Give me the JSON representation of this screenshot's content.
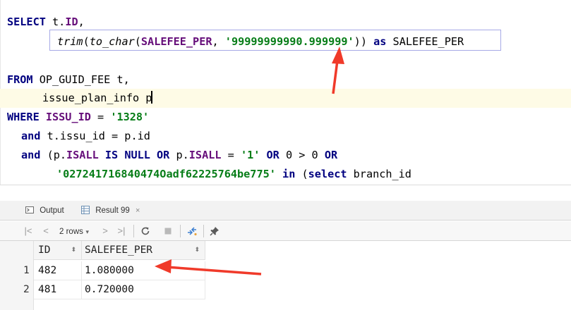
{
  "editor": {
    "lines": [
      {
        "parts": [
          {
            "t": "SELECT ",
            "c": "kw"
          },
          {
            "t": "t.",
            "c": ""
          },
          {
            "t": "ID",
            "c": "col"
          },
          {
            "t": ",",
            "c": ""
          }
        ]
      },
      {
        "parts": [
          {
            "t": "trim",
            "c": "fn"
          },
          {
            "t": "(",
            "c": ""
          },
          {
            "t": "to_char",
            "c": "fn"
          },
          {
            "t": "(",
            "c": ""
          },
          {
            "t": "SALEFEE_PER",
            "c": "col"
          },
          {
            "t": ", ",
            "c": ""
          },
          {
            "t": "'99999999990.999999'",
            "c": "str"
          },
          {
            "t": ")) ",
            "c": ""
          },
          {
            "t": "as ",
            "c": "kw"
          },
          {
            "t": "SALEFEE_PER",
            "c": ""
          }
        ]
      },
      {
        "parts": []
      },
      {
        "parts": [
          {
            "t": "FROM ",
            "c": "kw"
          },
          {
            "t": "OP_GUID_FEE t,",
            "c": ""
          }
        ]
      },
      {
        "parts": [
          {
            "t": "issue_plan_info p",
            "c": ""
          }
        ],
        "highlight": true
      },
      {
        "parts": [
          {
            "t": "WHERE ",
            "c": "kw"
          },
          {
            "t": "ISSU_ID",
            "c": "col"
          },
          {
            "t": " = ",
            "c": ""
          },
          {
            "t": "'1328'",
            "c": "str"
          }
        ]
      },
      {
        "parts": [
          {
            "t": "and ",
            "c": "kw"
          },
          {
            "t": "t.issu_id = p.id",
            "c": ""
          }
        ]
      },
      {
        "parts": [
          {
            "t": "and ",
            "c": "kw"
          },
          {
            "t": "(p.",
            "c": ""
          },
          {
            "t": "ISALL",
            "c": "col"
          },
          {
            "t": " ",
            "c": ""
          },
          {
            "t": "IS NULL OR ",
            "c": "kw"
          },
          {
            "t": "p.",
            "c": ""
          },
          {
            "t": "ISALL",
            "c": "col"
          },
          {
            "t": " = ",
            "c": ""
          },
          {
            "t": "'1'",
            "c": "str"
          },
          {
            "t": " ",
            "c": ""
          },
          {
            "t": "OR ",
            "c": "kw"
          },
          {
            "t": "0 > 0 ",
            "c": ""
          },
          {
            "t": "OR",
            "c": "kw"
          }
        ]
      },
      {
        "parts": [
          {
            "t": "'027241716840474Oadf62225764be775'",
            "c": "str"
          },
          {
            "t": " ",
            "c": ""
          },
          {
            "t": "in ",
            "c": "kw"
          },
          {
            "t": "(",
            "c": ""
          },
          {
            "t": "select ",
            "c": "kw"
          },
          {
            "t": "branch_id",
            "c": ""
          }
        ]
      }
    ]
  },
  "tabs": {
    "output_label": "Output",
    "result_label": "Result 99",
    "close_glyph": "×"
  },
  "toolbar": {
    "rows_label": "2 rows",
    "first_glyph": "|<",
    "prev_glyph": "<",
    "next_glyph": ">",
    "last_glyph": ">|",
    "dropdown_glyph": "▾"
  },
  "grid": {
    "columns": [
      "ID",
      "SALEFEE_PER"
    ],
    "sort_glyph": "⬍",
    "rows": [
      {
        "num": "1",
        "cells": [
          "482",
          "1.080000"
        ]
      },
      {
        "num": "2",
        "cells": [
          "481",
          "0.720000"
        ]
      }
    ]
  },
  "colors": {
    "keyword": "#000080",
    "string": "#067d17",
    "column": "#660e7a",
    "arrow": "#f03a2a"
  }
}
